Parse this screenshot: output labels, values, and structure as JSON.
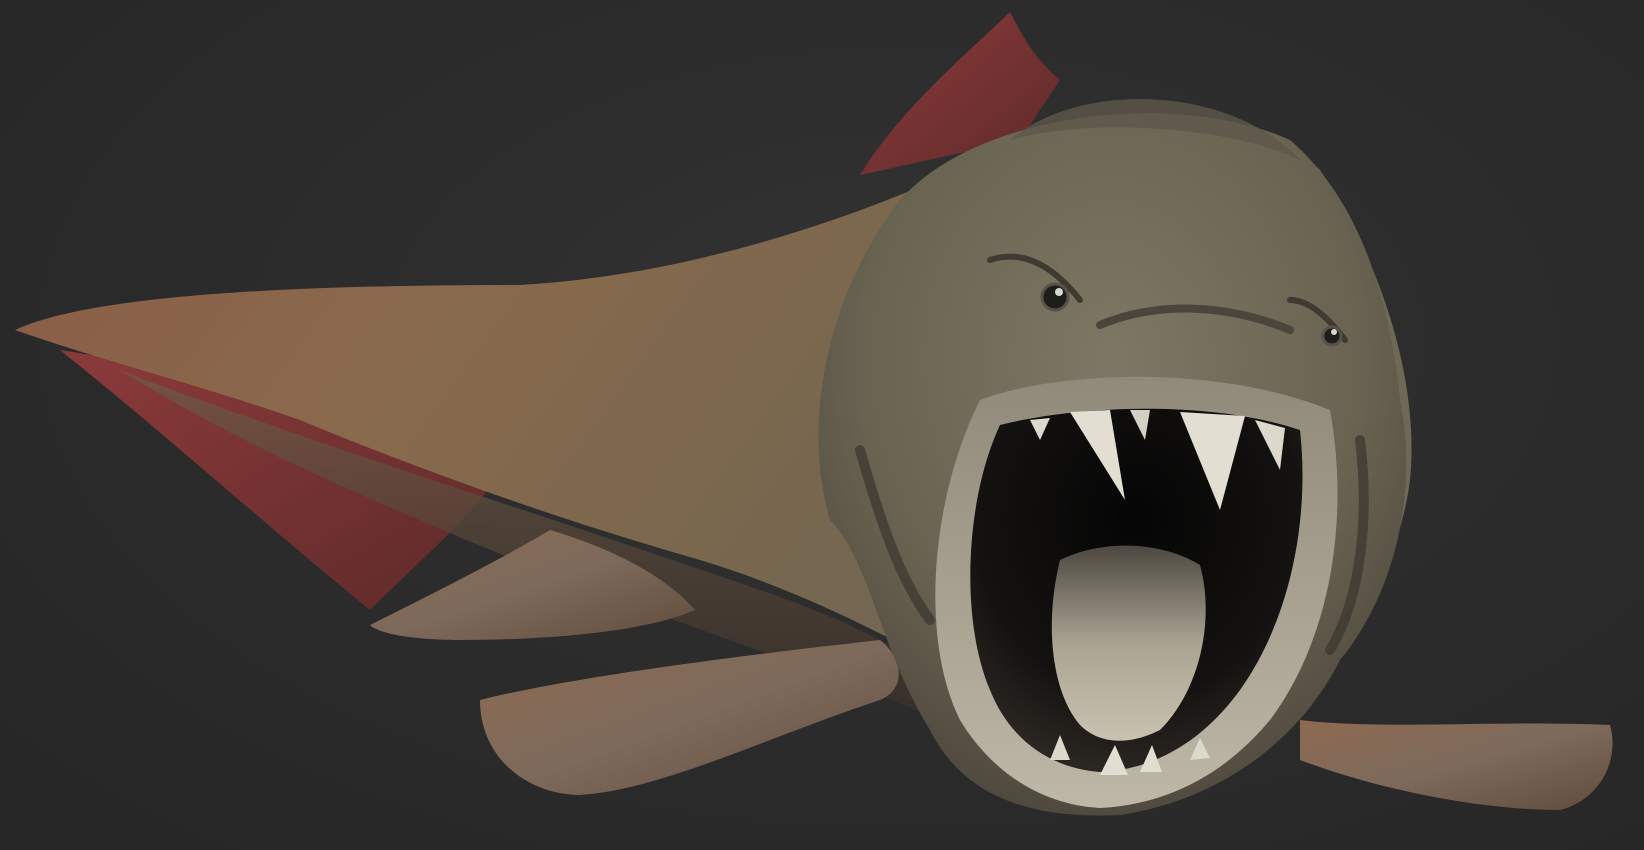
{
  "scene": {
    "subject": "3d-render-prehistoric-armored-fish",
    "colors": {
      "background": "#2b2b2b",
      "body_brown": "#7a6046",
      "head_grey": "#6e6857",
      "fin_red": "#7a3535",
      "mouth_dark": "#0e0d0c",
      "tooth_white": "#dcd8cc"
    }
  }
}
